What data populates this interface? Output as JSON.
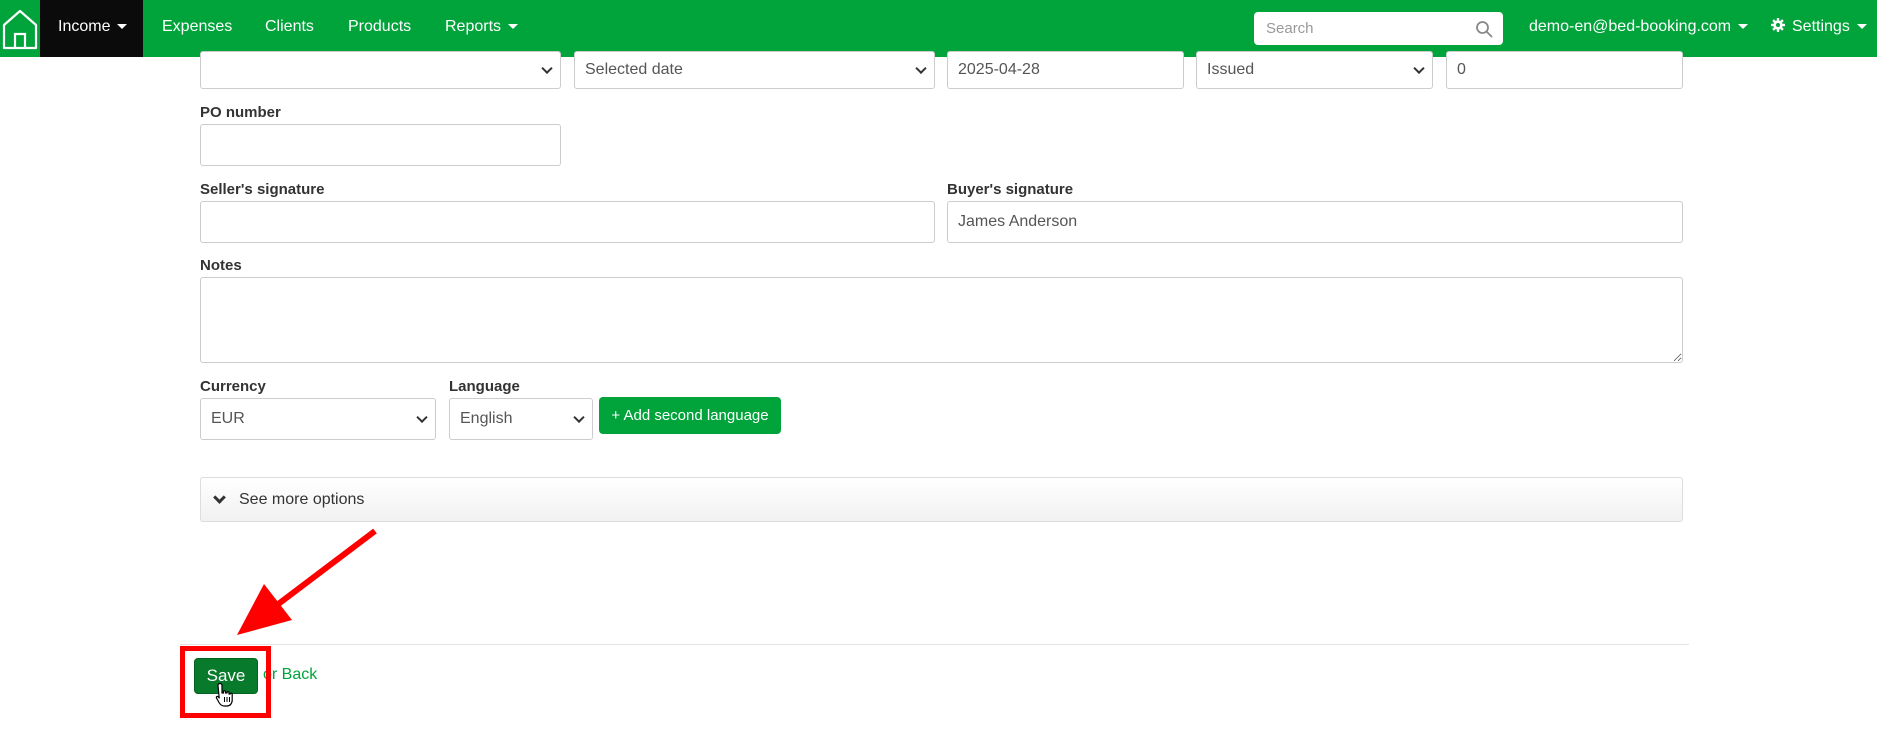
{
  "navbar": {
    "items": [
      {
        "label": "Income",
        "active": true,
        "dropdown": true
      },
      {
        "label": "Expenses"
      },
      {
        "label": "Clients"
      },
      {
        "label": "Products"
      },
      {
        "label": "Reports",
        "dropdown": true
      }
    ],
    "search": {
      "placeholder": "Search",
      "value": ""
    },
    "user": {
      "label": "demo-en@bed-booking.com"
    },
    "settings": {
      "label": "Settings"
    },
    "home_icon": "home-icon",
    "accent_color": "#01a33b"
  },
  "form": {
    "top_row": {
      "blank_select": "",
      "date_select": "Selected date",
      "date_value": "2025-04-28",
      "status_select": "Issued",
      "number_value": "0"
    },
    "po_number": {
      "label": "PO number",
      "value": ""
    },
    "seller_signature": {
      "label": "Seller's signature",
      "value": ""
    },
    "buyer_signature": {
      "label": "Buyer's signature",
      "value": "James Anderson"
    },
    "notes": {
      "label": "Notes",
      "value": ""
    },
    "currency": {
      "label": "Currency",
      "value": "EUR"
    },
    "language": {
      "label": "Language",
      "value": "English"
    },
    "add_language_button": "+ Add second language",
    "more_options": "See more options"
  },
  "actions": {
    "save": "Save",
    "or_back": "or Back"
  },
  "annotation": {
    "color": "#ff0000"
  }
}
